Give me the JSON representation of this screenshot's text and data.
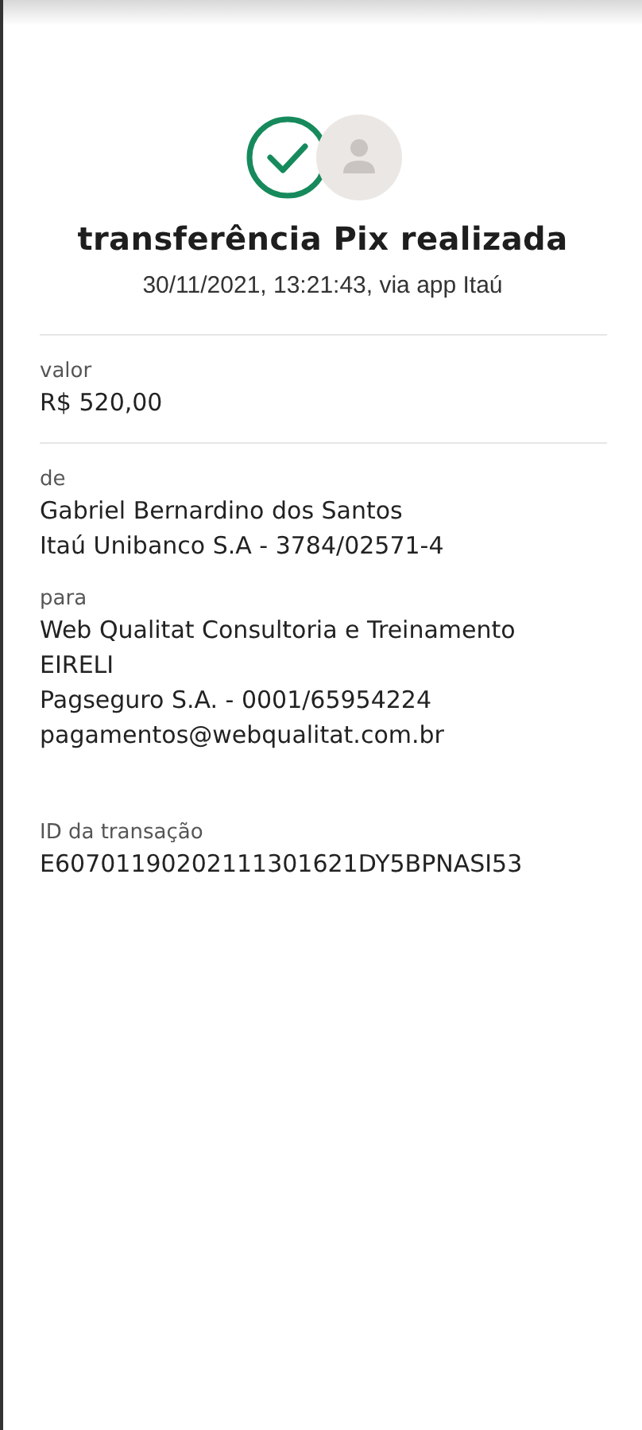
{
  "header": {
    "title": "transferência Pix realizada",
    "subtitle": "30/11/2021,  13:21:43, via app Itaú"
  },
  "sections": [
    {
      "label": "valor",
      "lines": [
        "R$ 520,00"
      ],
      "divider_after": true
    },
    {
      "label": "de",
      "lines": [
        "Gabriel Bernardino dos Santos",
        "Itaú Unibanco S.A - 3784/02571-4"
      ],
      "divider_after": false
    },
    {
      "label": "para",
      "lines": [
        "Web Qualitat Consultoria e Treinamento",
        "EIRELI",
        "Pagseguro S.A. - 0001/65954224",
        "pagamentos@webqualitat.com.br"
      ],
      "divider_after": false
    },
    {
      "label": "ID da transação",
      "lines": [
        "E60701190202111301621DY5BPNASI53"
      ],
      "divider_after": false
    }
  ]
}
